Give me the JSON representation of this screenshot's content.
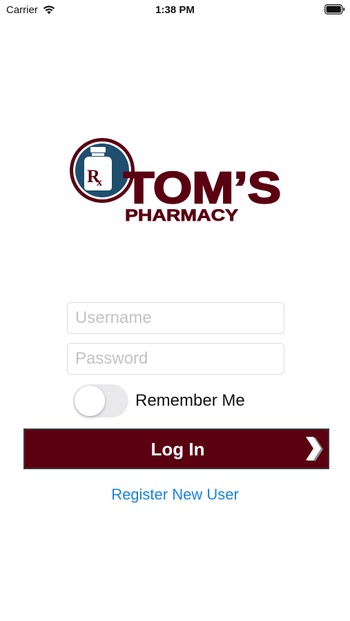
{
  "status_bar": {
    "carrier": "Carrier",
    "time": "1:38 PM",
    "wifi_icon": "wifi-icon",
    "battery_icon": "battery-icon"
  },
  "logo": {
    "name": "TOM'S",
    "subtitle": "PHARMACY",
    "rx": "Rx"
  },
  "login_form": {
    "username_placeholder": "Username",
    "username_value": "",
    "password_placeholder": "Password",
    "password_value": "",
    "remember_me_label": "Remember Me",
    "remember_me_on": false,
    "login_label": "Log In",
    "register_label": "Register New User"
  },
  "colors": {
    "brand_maroon": "#5a0011",
    "brand_blue": "#1f4e6e",
    "link_blue": "#1a82e0",
    "toggle_off": "#e9e9eb"
  }
}
